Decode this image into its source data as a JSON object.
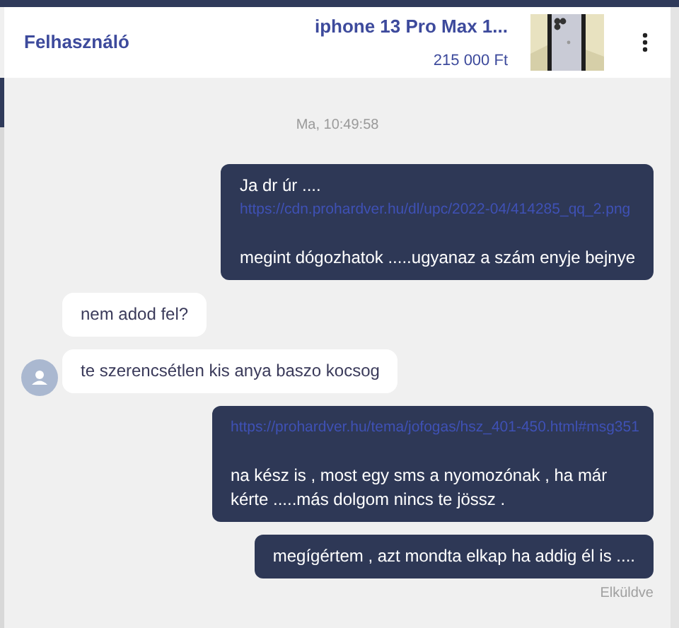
{
  "header": {
    "user": "Felhasználó",
    "listing_title": "iphone 13 Pro Max 1...",
    "price": "215 000 Ft"
  },
  "timestamp": "Ma, 10:49:58",
  "messages": [
    {
      "kind": "sent",
      "paragraphs": [
        [
          {
            "kind": "text",
            "text": "Ja dr úr ...."
          },
          {
            "kind": "link",
            "text": "https://cdn.prohardver.hu/dl/upc/2022-04/414285_qq_2.png"
          }
        ],
        [
          {
            "kind": "text",
            "text": "megint dógozhatok .....ugyanaz a szám enyje bejnye"
          }
        ]
      ]
    },
    {
      "kind": "received",
      "avatar": false,
      "paragraphs": [
        [
          {
            "kind": "text",
            "text": "nem adod fel?"
          }
        ]
      ]
    },
    {
      "kind": "received",
      "avatar": true,
      "paragraphs": [
        [
          {
            "kind": "text",
            "text": "te szerencsétlen kis anya baszo kocsog"
          }
        ]
      ]
    },
    {
      "kind": "sent",
      "paragraphs": [
        [
          {
            "kind": "link",
            "text": "https://prohardver.hu/tema/jofogas/hsz_401-450.html#msg351"
          }
        ],
        [
          {
            "kind": "text",
            "text": "na kész is , most egy sms a nyomozónak , ha már kérte .....más dolgom nincs te jössz ."
          }
        ]
      ]
    },
    {
      "kind": "sent",
      "paragraphs": [
        [
          {
            "kind": "text",
            "text": "megígértem , azt mondta elkap ha addig él is ...."
          }
        ]
      ]
    }
  ],
  "delivery_status": "Elküldve"
}
